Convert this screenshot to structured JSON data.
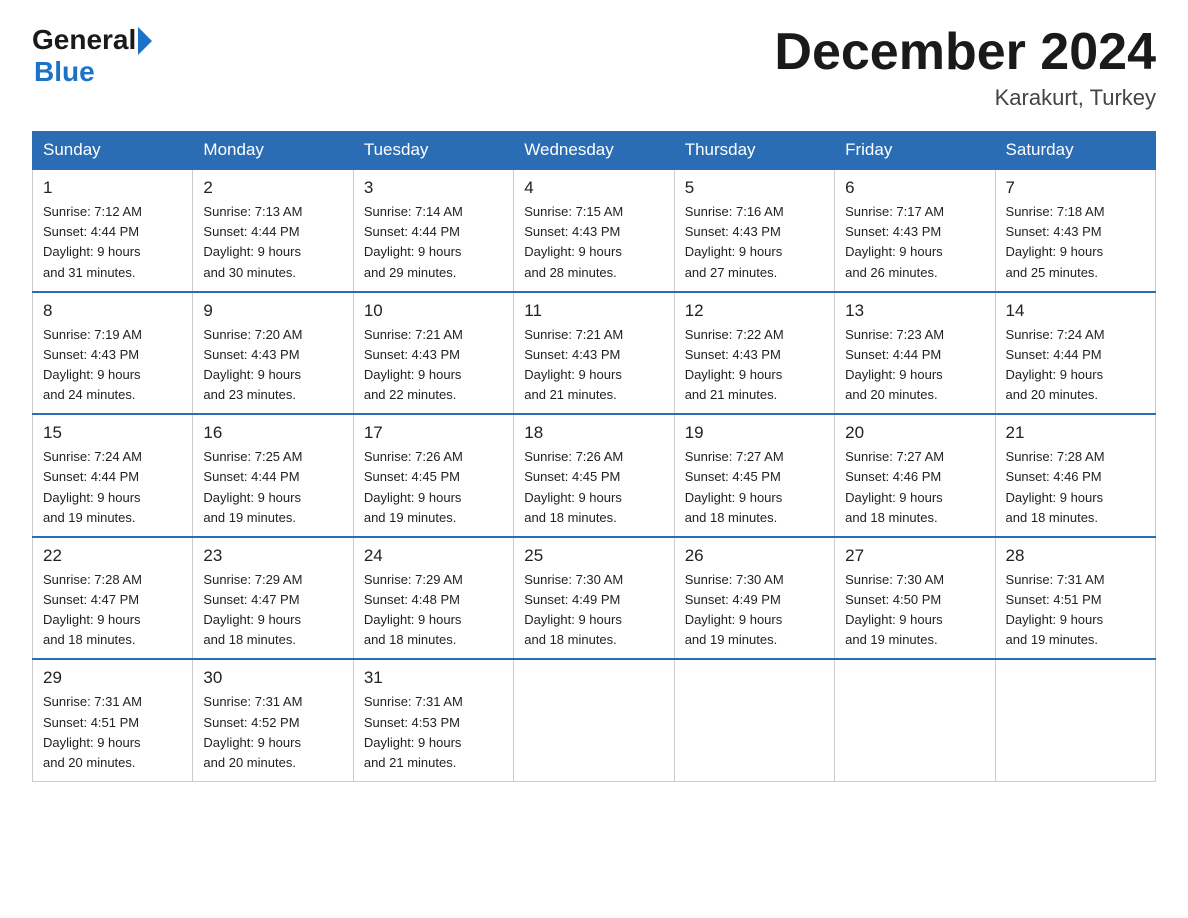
{
  "header": {
    "logo_general": "General",
    "logo_blue": "Blue",
    "month_title": "December 2024",
    "location": "Karakurt, Turkey"
  },
  "days_of_week": [
    "Sunday",
    "Monday",
    "Tuesday",
    "Wednesday",
    "Thursday",
    "Friday",
    "Saturday"
  ],
  "weeks": [
    [
      {
        "day": "1",
        "sunrise": "7:12 AM",
        "sunset": "4:44 PM",
        "daylight": "9 hours and 31 minutes."
      },
      {
        "day": "2",
        "sunrise": "7:13 AM",
        "sunset": "4:44 PM",
        "daylight": "9 hours and 30 minutes."
      },
      {
        "day": "3",
        "sunrise": "7:14 AM",
        "sunset": "4:44 PM",
        "daylight": "9 hours and 29 minutes."
      },
      {
        "day": "4",
        "sunrise": "7:15 AM",
        "sunset": "4:43 PM",
        "daylight": "9 hours and 28 minutes."
      },
      {
        "day": "5",
        "sunrise": "7:16 AM",
        "sunset": "4:43 PM",
        "daylight": "9 hours and 27 minutes."
      },
      {
        "day": "6",
        "sunrise": "7:17 AM",
        "sunset": "4:43 PM",
        "daylight": "9 hours and 26 minutes."
      },
      {
        "day": "7",
        "sunrise": "7:18 AM",
        "sunset": "4:43 PM",
        "daylight": "9 hours and 25 minutes."
      }
    ],
    [
      {
        "day": "8",
        "sunrise": "7:19 AM",
        "sunset": "4:43 PM",
        "daylight": "9 hours and 24 minutes."
      },
      {
        "day": "9",
        "sunrise": "7:20 AM",
        "sunset": "4:43 PM",
        "daylight": "9 hours and 23 minutes."
      },
      {
        "day": "10",
        "sunrise": "7:21 AM",
        "sunset": "4:43 PM",
        "daylight": "9 hours and 22 minutes."
      },
      {
        "day": "11",
        "sunrise": "7:21 AM",
        "sunset": "4:43 PM",
        "daylight": "9 hours and 21 minutes."
      },
      {
        "day": "12",
        "sunrise": "7:22 AM",
        "sunset": "4:43 PM",
        "daylight": "9 hours and 21 minutes."
      },
      {
        "day": "13",
        "sunrise": "7:23 AM",
        "sunset": "4:44 PM",
        "daylight": "9 hours and 20 minutes."
      },
      {
        "day": "14",
        "sunrise": "7:24 AM",
        "sunset": "4:44 PM",
        "daylight": "9 hours and 20 minutes."
      }
    ],
    [
      {
        "day": "15",
        "sunrise": "7:24 AM",
        "sunset": "4:44 PM",
        "daylight": "9 hours and 19 minutes."
      },
      {
        "day": "16",
        "sunrise": "7:25 AM",
        "sunset": "4:44 PM",
        "daylight": "9 hours and 19 minutes."
      },
      {
        "day": "17",
        "sunrise": "7:26 AM",
        "sunset": "4:45 PM",
        "daylight": "9 hours and 19 minutes."
      },
      {
        "day": "18",
        "sunrise": "7:26 AM",
        "sunset": "4:45 PM",
        "daylight": "9 hours and 18 minutes."
      },
      {
        "day": "19",
        "sunrise": "7:27 AM",
        "sunset": "4:45 PM",
        "daylight": "9 hours and 18 minutes."
      },
      {
        "day": "20",
        "sunrise": "7:27 AM",
        "sunset": "4:46 PM",
        "daylight": "9 hours and 18 minutes."
      },
      {
        "day": "21",
        "sunrise": "7:28 AM",
        "sunset": "4:46 PM",
        "daylight": "9 hours and 18 minutes."
      }
    ],
    [
      {
        "day": "22",
        "sunrise": "7:28 AM",
        "sunset": "4:47 PM",
        "daylight": "9 hours and 18 minutes."
      },
      {
        "day": "23",
        "sunrise": "7:29 AM",
        "sunset": "4:47 PM",
        "daylight": "9 hours and 18 minutes."
      },
      {
        "day": "24",
        "sunrise": "7:29 AM",
        "sunset": "4:48 PM",
        "daylight": "9 hours and 18 minutes."
      },
      {
        "day": "25",
        "sunrise": "7:30 AM",
        "sunset": "4:49 PM",
        "daylight": "9 hours and 18 minutes."
      },
      {
        "day": "26",
        "sunrise": "7:30 AM",
        "sunset": "4:49 PM",
        "daylight": "9 hours and 19 minutes."
      },
      {
        "day": "27",
        "sunrise": "7:30 AM",
        "sunset": "4:50 PM",
        "daylight": "9 hours and 19 minutes."
      },
      {
        "day": "28",
        "sunrise": "7:31 AM",
        "sunset": "4:51 PM",
        "daylight": "9 hours and 19 minutes."
      }
    ],
    [
      {
        "day": "29",
        "sunrise": "7:31 AM",
        "sunset": "4:51 PM",
        "daylight": "9 hours and 20 minutes."
      },
      {
        "day": "30",
        "sunrise": "7:31 AM",
        "sunset": "4:52 PM",
        "daylight": "9 hours and 20 minutes."
      },
      {
        "day": "31",
        "sunrise": "7:31 AM",
        "sunset": "4:53 PM",
        "daylight": "9 hours and 21 minutes."
      },
      null,
      null,
      null,
      null
    ]
  ],
  "labels": {
    "sunrise_prefix": "Sunrise: ",
    "sunset_prefix": "Sunset: ",
    "daylight_prefix": "Daylight: "
  }
}
